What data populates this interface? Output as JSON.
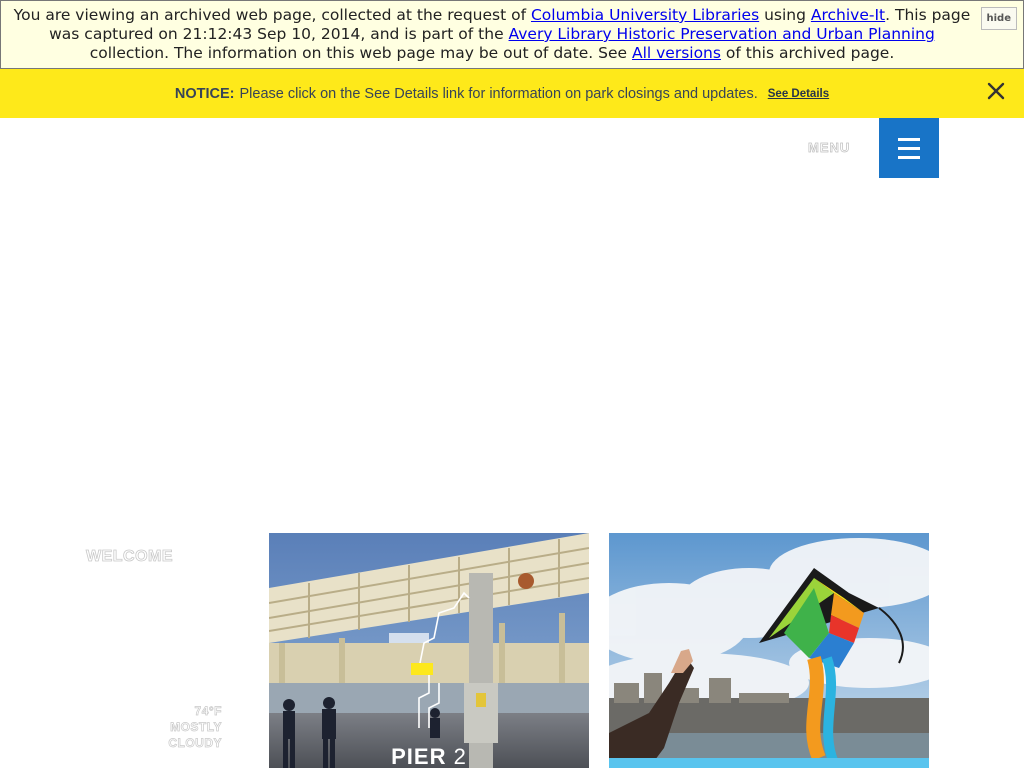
{
  "archive_banner": {
    "text_1": "You are viewing an archived web page, collected at the request of ",
    "link_1": "Columbia University Libraries",
    "text_2": " using ",
    "link_2": "Archive-It",
    "text_3": ". This page was captured on 21:12:43 Sep 10, 2014, and is part of the ",
    "link_3": "Avery Library Historic Preservation and Urban Planning",
    "text_4": " collection. The information on this web page may be out of date. See ",
    "link_4": "All versions",
    "text_5": " of this archived page.",
    "hide_label": "hide"
  },
  "notice": {
    "label": "NOTICE:",
    "message": "Please click on the See Details link for information on park closings and updates.",
    "link": "See Details",
    "close_icon": "close-icon"
  },
  "header": {
    "menu_label": "MENU",
    "menu_icon": "hamburger-icon"
  },
  "sidebar": {
    "welcome": "WELCOME",
    "weather_temp": "74°F",
    "weather_line1": "MOSTLY",
    "weather_line2": "CLOUDY"
  },
  "cards": {
    "pier": {
      "label_bold": "PIER",
      "label_num": "2"
    }
  },
  "colors": {
    "notice_bg": "#fee91a",
    "menu_button": "#1874c7",
    "kite_strip": "#59c4ee"
  }
}
